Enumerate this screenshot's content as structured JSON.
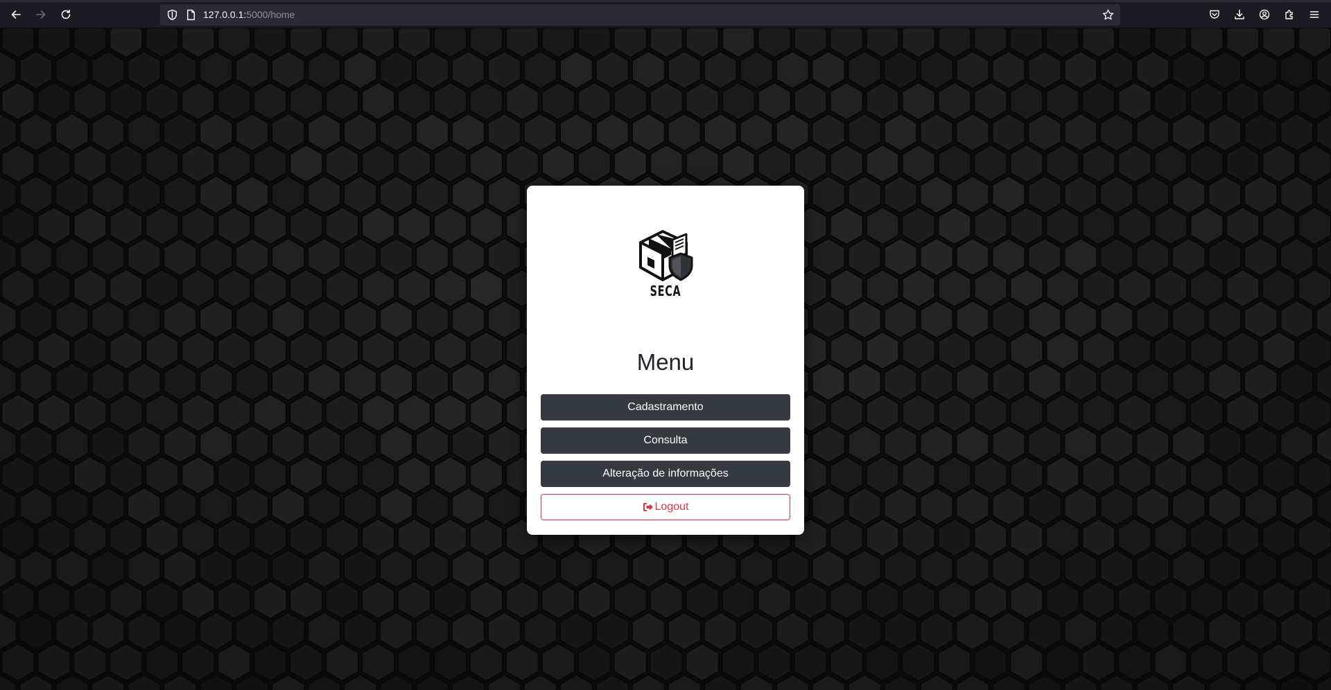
{
  "browser": {
    "url_host": "127.0.0.1:",
    "url_path": "5000/home",
    "icons": {
      "back": "back-arrow-icon",
      "forward": "forward-arrow-icon",
      "reload": "reload-icon",
      "shield": "tracking-protection-shield-icon",
      "page": "page-info-icon",
      "bookmark": "bookmark-star-icon",
      "pocket": "pocket-icon",
      "downloads": "downloads-icon",
      "account": "account-icon",
      "extensions": "extensions-icon",
      "menu": "hamburger-menu-icon"
    }
  },
  "card": {
    "logo_text": "SECA",
    "title": "Menu",
    "buttons": [
      {
        "label": "Cadastramento"
      },
      {
        "label": "Consulta"
      },
      {
        "label": "Alteração de informações"
      }
    ],
    "logout_label": "Logout",
    "logout_icon": "sign-out-icon"
  },
  "colors": {
    "button_dark": "#343a40",
    "danger": "#dc3545",
    "chrome_bg": "#1c1b22",
    "urlbar_bg": "#2b2a33"
  }
}
